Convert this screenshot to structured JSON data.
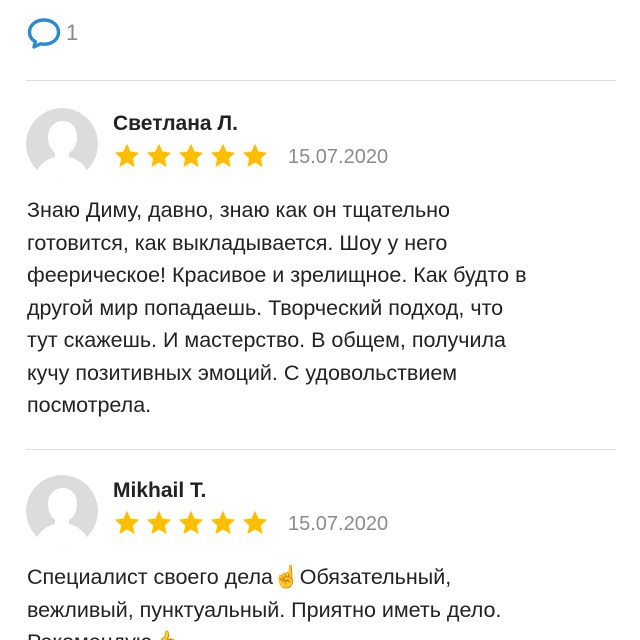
{
  "comments": {
    "count": "1",
    "icon": "comment-icon"
  },
  "colors": {
    "star": "#ffbf00",
    "accent_icon": "#2b8bd1",
    "date": "#8c8c8c",
    "avatar_bg": "#dcdcdc",
    "avatar_fg": "#ffffff"
  },
  "reviews": [
    {
      "author": "Светлана Л.",
      "rating": 5,
      "date": "15.07.2020",
      "text": "Знаю Диму, давно, знаю как он тщательно\nготовится,  как выкладывается.  Шоу у него\nфеерическое! Красивое и зрелищное.  Как будто в\nдругой мир попадаешь. Творческий подход, что\nтут скажешь. И мастерство. В общем, получила\nкучу позитивных эмоций. С удовольствием\nпосмотрела."
    },
    {
      "author": "Mikhail T.",
      "rating": 5,
      "date": "15.07.2020",
      "text": "Специалист своего дела☝️Обязательный,\nвежливый, пунктуальный. Приятно иметь дело.\nРекомендую👍"
    }
  ]
}
